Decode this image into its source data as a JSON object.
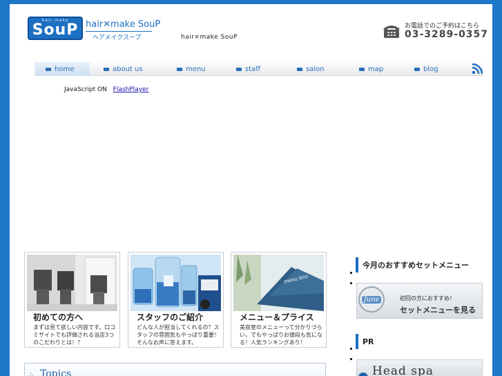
{
  "header": {
    "logo_small": "hair make",
    "logo_big": "SouP",
    "brand_en": "hair✕make SouP",
    "brand_kana": "ヘアメイクスープ",
    "tagline": "hair×make SouP",
    "phone_caption": "お電話でのご予約はこちら",
    "phone_number": "03-3289-0357"
  },
  "nav": {
    "items": [
      {
        "label": "home",
        "active": true
      },
      {
        "label": "about us"
      },
      {
        "label": "menu"
      },
      {
        "label": "staff"
      },
      {
        "label": "salon"
      },
      {
        "label": "map"
      },
      {
        "label": "blog"
      }
    ]
  },
  "flash_notice": {
    "text": "JavaScript ON",
    "link": "FlashPlayer"
  },
  "cards": [
    {
      "title": "初めての方へ",
      "desc": "まずは見て欲しい内容です。口コミサイトでも評価される当店3つのこだわりとは！？"
    },
    {
      "title": "スタッフのご紹介",
      "desc": "どんな人が担当してくれるの？スタッフの雰囲気もやっぱり重要！そんなお声に答えます。"
    },
    {
      "title": "メニュー＆プライス",
      "desc": "美容室のメニューって分かりづらい。でもやっぱりお値段も気になる！人気ランキングあり！",
      "sign": "menu boo"
    }
  ],
  "topics": {
    "title": "Topics"
  },
  "sidebar": {
    "recommend_heading": "今月のおすすめセットメニュー",
    "recommend_banner": {
      "month": "June",
      "sub": "初回の方におすすめ！",
      "main": "セットメニューを見る"
    },
    "pr_heading": "PR",
    "pr_banner": {
      "text": "Head spa"
    }
  },
  "colors": {
    "background": "#1e78c8",
    "accent": "#1d6fc2",
    "nav_text": "#2a6fb8"
  }
}
